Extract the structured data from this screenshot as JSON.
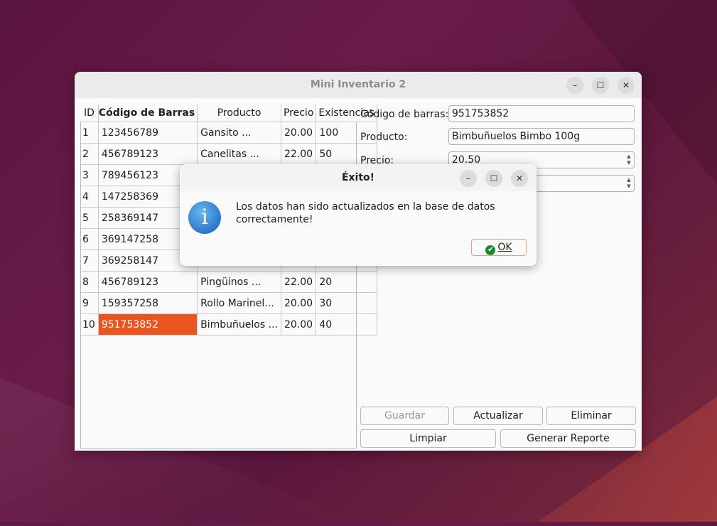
{
  "window": {
    "title": "Mini Inventario 2"
  },
  "table": {
    "headers": [
      "ID",
      "Código de Barras",
      "Producto",
      "Precio",
      "Existencias"
    ],
    "rows": [
      [
        "1",
        "123456789",
        "Gansito ...",
        "20.00",
        "100"
      ],
      [
        "2",
        "456789123",
        "Canelitas ...",
        "22.00",
        "50"
      ],
      [
        "3",
        "789456123",
        "",
        "",
        ""
      ],
      [
        "4",
        "147258369",
        "",
        "",
        ""
      ],
      [
        "5",
        "258369147",
        "",
        "",
        ""
      ],
      [
        "6",
        "369147258",
        "",
        "",
        ""
      ],
      [
        "7",
        "369258147",
        "",
        "",
        ""
      ],
      [
        "8",
        "456789123",
        "Pingüinos ...",
        "22.00",
        "20"
      ],
      [
        "9",
        "159357258",
        "Rollo Marinel...",
        "20.00",
        "30"
      ],
      [
        "10",
        "951753852",
        "Bimbuñuelos ...",
        "20.00",
        "40"
      ]
    ],
    "selected_row": 10
  },
  "form": {
    "codigo_label": "Código de barras:",
    "codigo_value": "951753852",
    "producto_label": "Producto:",
    "producto_value": "Bimbuñuelos Bimbo 100g",
    "precio_label": "Precio:",
    "precio_value": "20.50",
    "existencias_value": ""
  },
  "buttons": {
    "guardar": "Guardar",
    "actualizar": "Actualizar",
    "eliminar": "Eliminar",
    "limpiar": "Limpiar",
    "reporte": "Generar Reporte"
  },
  "dialog": {
    "title": "Éxito!",
    "message": "Los datos han sido actualizados en la base de datos correctamente!",
    "ok_label": "OK"
  },
  "colors": {
    "selection": "#e95420",
    "accent": "#e95420"
  }
}
